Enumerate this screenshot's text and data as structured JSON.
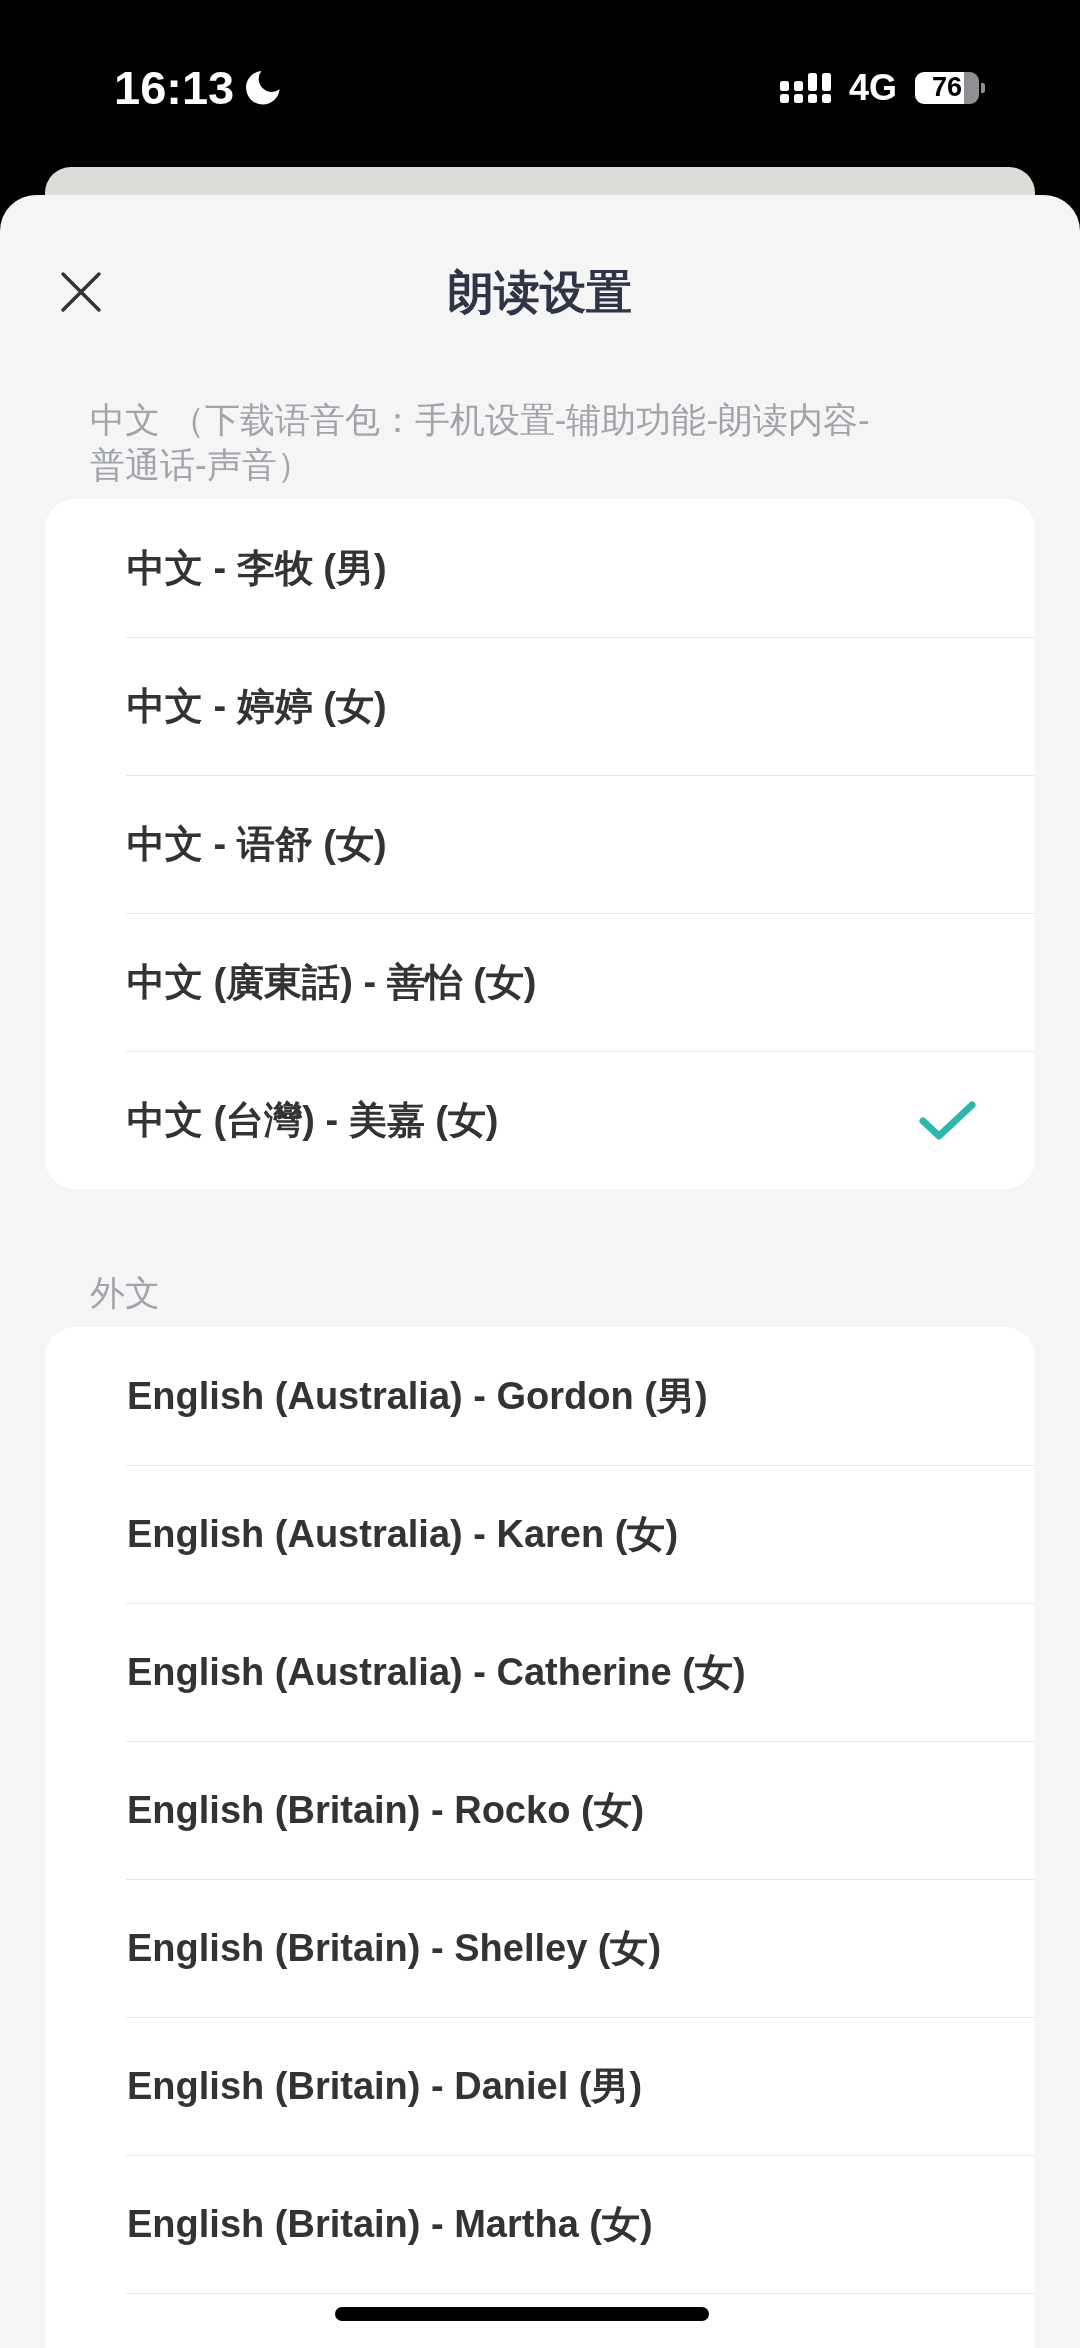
{
  "status_bar": {
    "time": "16:13",
    "network": "4G",
    "battery": "76"
  },
  "sheet": {
    "title": "朗读设置"
  },
  "sections": [
    {
      "label": "中文 （下载语音包：手机设置-辅助功能-朗读内容-普通话-声音）",
      "voices": [
        {
          "name": "中文 - 李牧 (男)",
          "selected": false
        },
        {
          "name": "中文 - 婷婷 (女)",
          "selected": false
        },
        {
          "name": "中文 - 语舒 (女)",
          "selected": false
        },
        {
          "name": "中文 (廣東話) - 善怡 (女)",
          "selected": false
        },
        {
          "name": "中文 (台灣) - 美嘉 (女)",
          "selected": true
        }
      ]
    },
    {
      "label": "外文",
      "voices": [
        {
          "name": "English (Australia) - Gordon (男)",
          "selected": false
        },
        {
          "name": "English (Australia) - Karen (女)",
          "selected": false
        },
        {
          "name": "English (Australia) - Catherine (女)",
          "selected": false
        },
        {
          "name": "English (Britain) - Rocko (女)",
          "selected": false
        },
        {
          "name": "English (Britain) - Shelley (女)",
          "selected": false
        },
        {
          "name": "English (Britain) - Daniel (男)",
          "selected": false
        },
        {
          "name": "English (Britain) - Martha (女)",
          "selected": false
        }
      ]
    }
  ]
}
